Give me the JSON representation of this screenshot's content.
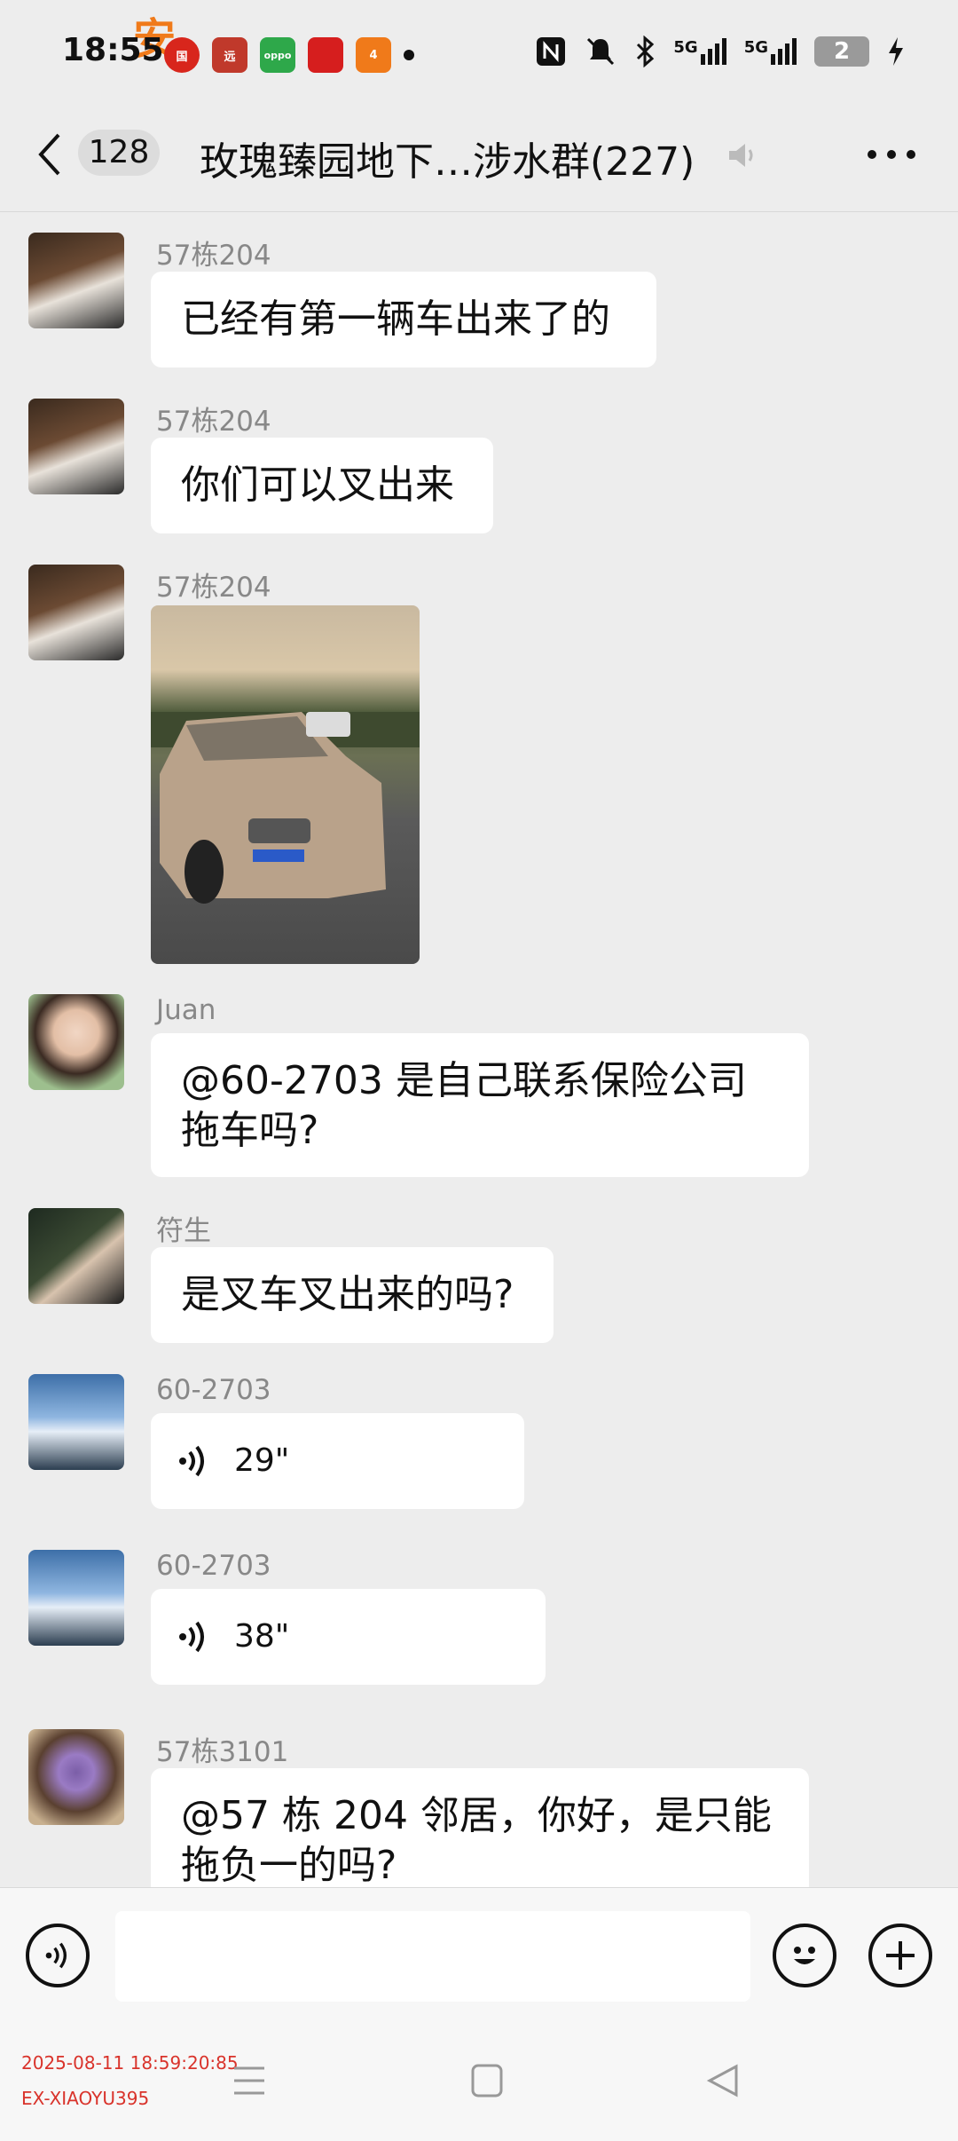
{
  "status_bar": {
    "time": "18:55",
    "watermark_char": "安",
    "notification_icons": [
      {
        "name": "app-icon-guo",
        "label": "国",
        "color": "#d8261c"
      },
      {
        "name": "app-icon-game",
        "label": "远",
        "color": "#c0392b"
      },
      {
        "name": "app-icon-oppo",
        "label": "oppo",
        "color": "#2ea84a"
      },
      {
        "name": "app-icon-red",
        "label": "",
        "color": "#d61e1e"
      },
      {
        "name": "app-icon-orange",
        "label": "4",
        "color": "#f07a1a"
      }
    ],
    "battery_level": "2",
    "network": "5G"
  },
  "header": {
    "unread_count": "128",
    "title": "玫瑰臻园地下…涉水群(227)"
  },
  "messages": [
    {
      "sender": "57栋204",
      "type": "text",
      "text": "已经有第一辆车出来了的",
      "avatar": "girl-white-shirt"
    },
    {
      "sender": "57栋204",
      "type": "text",
      "text": "你们可以叉出来",
      "avatar": "girl-white-shirt"
    },
    {
      "sender": "57栋204",
      "type": "image",
      "image_desc": "muddy-white-bmw-photo",
      "avatar": "girl-white-shirt"
    },
    {
      "sender": "Juan",
      "type": "text",
      "text": "@60-2703 是自己联系保险公司拖车吗?",
      "avatar": "child-portrait"
    },
    {
      "sender": "符生",
      "type": "text",
      "text": "是叉车叉出来的吗?",
      "avatar": "couple-dark"
    },
    {
      "sender": "60-2703",
      "type": "voice",
      "duration": "29\"",
      "avatar": "sky-road"
    },
    {
      "sender": "60-2703",
      "type": "voice",
      "duration": "38\"",
      "avatar": "sky-road"
    },
    {
      "sender": "57栋3101",
      "type": "text",
      "text": "@57 栋 204  邻居，你好，是只能拖负一的吗?",
      "avatar": "purple-flowers"
    }
  ],
  "input_bar": {
    "placeholder": ""
  },
  "footer": {
    "stamp_datetime": "2025-08-11 18:59:20:85",
    "stamp_id": "EX-XIAOYU395"
  },
  "colors": {
    "background": "#ededed",
    "bubble": "#ffffff",
    "sender_text": "#888888",
    "stamp": "#d9332b"
  }
}
